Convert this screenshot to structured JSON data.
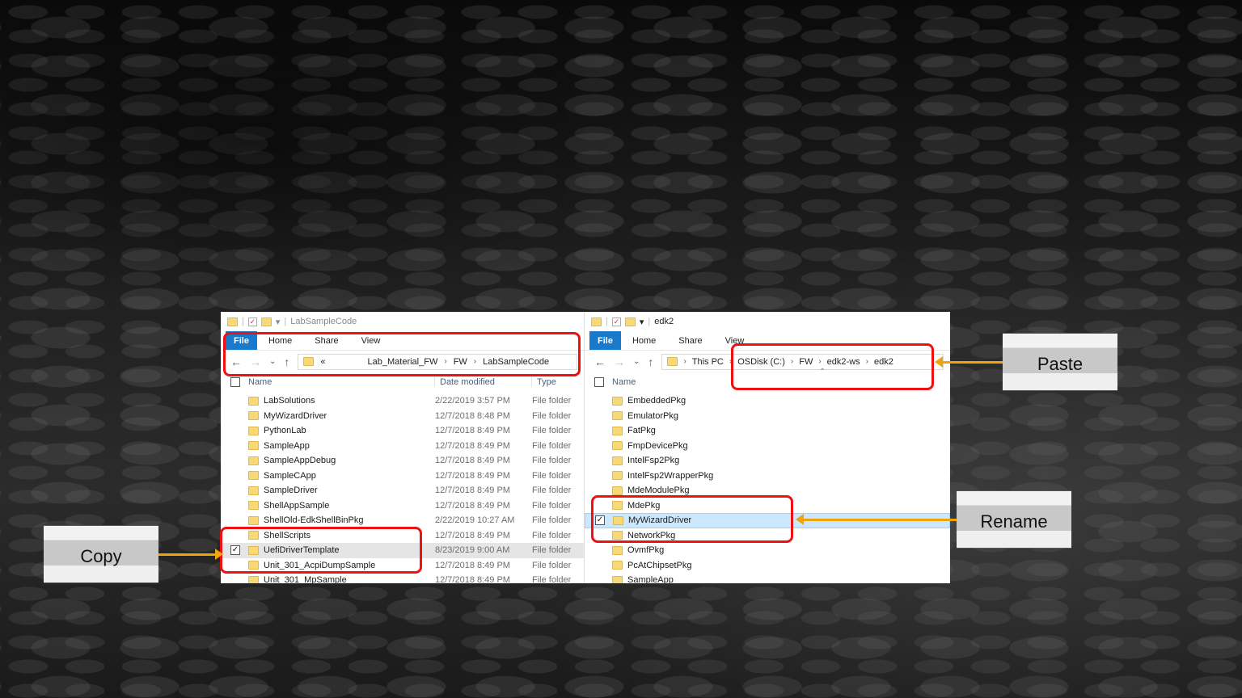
{
  "left_window": {
    "title": "LabSampleCode",
    "ribbon": {
      "file": "File",
      "home": "Home",
      "share": "Share",
      "view": "View"
    },
    "address": {
      "prefix": "«",
      "crumbs": [
        "Lab_Material_FW",
        "FW",
        "LabSampleCode"
      ]
    },
    "columns": {
      "name": "Name",
      "date": "Date modified",
      "type": "Type"
    },
    "rows": [
      {
        "name": "LabSolutions",
        "date": "2/22/2019 3:57 PM",
        "type": "File folder"
      },
      {
        "name": "MyWizardDriver",
        "date": "12/7/2018 8:48 PM",
        "type": "File folder"
      },
      {
        "name": "PythonLab",
        "date": "12/7/2018 8:49 PM",
        "type": "File folder"
      },
      {
        "name": "SampleApp",
        "date": "12/7/2018 8:49 PM",
        "type": "File folder"
      },
      {
        "name": "SampleAppDebug",
        "date": "12/7/2018 8:49 PM",
        "type": "File folder"
      },
      {
        "name": "SampleCApp",
        "date": "12/7/2018 8:49 PM",
        "type": "File folder"
      },
      {
        "name": "SampleDriver",
        "date": "12/7/2018 8:49 PM",
        "type": "File folder"
      },
      {
        "name": "ShellAppSample",
        "date": "12/7/2018 8:49 PM",
        "type": "File folder"
      },
      {
        "name": "ShellOld-EdkShellBinPkg",
        "date": "2/22/2019 10:27 AM",
        "type": "File folder"
      },
      {
        "name": "ShellScripts",
        "date": "12/7/2018 8:49 PM",
        "type": "File folder"
      },
      {
        "name": "UefiDriverTemplate",
        "date": "8/23/2019 9:00 AM",
        "type": "File folder",
        "selected": true
      },
      {
        "name": "Unit_301_AcpiDumpSample",
        "date": "12/7/2018 8:49 PM",
        "type": "File folder"
      },
      {
        "name": "Unit_301_MpSample",
        "date": "12/7/2018 8:49 PM",
        "type": "File folder"
      }
    ]
  },
  "right_window": {
    "title": "edk2",
    "ribbon": {
      "file": "File",
      "home": "Home",
      "share": "Share",
      "view": "View"
    },
    "address": {
      "crumbs": [
        "This PC",
        "OSDisk (C:)",
        "FW",
        "edk2-ws",
        "edk2"
      ]
    },
    "columns": {
      "name": "Name"
    },
    "rows": [
      {
        "name": "EmbeddedPkg"
      },
      {
        "name": "EmulatorPkg"
      },
      {
        "name": "FatPkg"
      },
      {
        "name": "FmpDevicePkg"
      },
      {
        "name": "IntelFsp2Pkg"
      },
      {
        "name": "IntelFsp2WrapperPkg"
      },
      {
        "name": "MdeModulePkg"
      },
      {
        "name": "MdePkg"
      },
      {
        "name": "MyWizardDriver",
        "selected": true
      },
      {
        "name": "NetworkPkg"
      },
      {
        "name": "OvmfPkg"
      },
      {
        "name": "PcAtChipsetPkg"
      },
      {
        "name": "SampleApp"
      }
    ]
  },
  "callouts": {
    "copy": "Copy",
    "paste": "Paste",
    "rename": "Rename"
  },
  "colors": {
    "accent": "#1979ca",
    "highlight": "#e11111",
    "arrow": "#f0a30a"
  }
}
